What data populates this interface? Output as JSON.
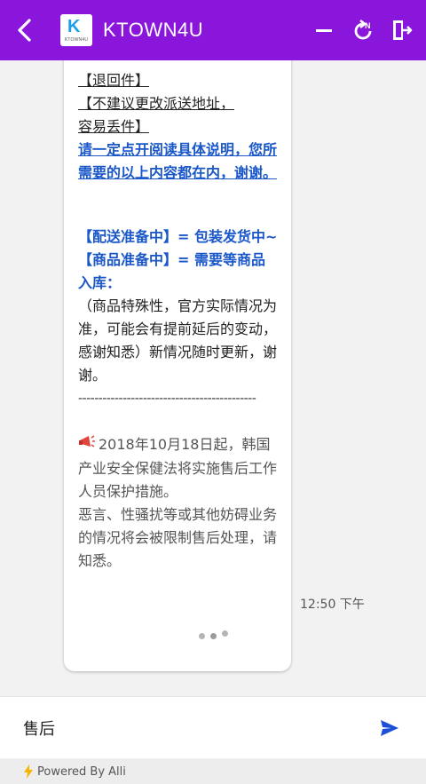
{
  "colors": {
    "appbar": "#8a16dc",
    "link_blue": "#1a57c8",
    "send_blue": "#1a4fd6",
    "bolt": "#f5b400"
  },
  "header": {
    "title": "KTOWN4U",
    "logo_letter": "K",
    "logo_text": "KTOWN4U",
    "refresh_badge": "N"
  },
  "message": {
    "lines": {
      "l1": "【退回件】",
      "l2": "【不建议更改派送地址，",
      "l3": "容易丢件】",
      "link": "请一定点开阅读具体说明，您所需要的以上内容都在内，谢谢。",
      "status1": "【配送准备中】= 包装发货中~",
      "status2": "【商品准备中】= 需要等商品入库：",
      "note": "（商品特殊性，官方实际情况为准，可能会有提前延后的变动，感谢知悉）新情况随时更新，谢谢。",
      "divider": "--------------------------------------------",
      "notice1": "2018年10月18日起，韩国产业安全保健法将实施售后工作人员保护措施。",
      "notice2": "恶言、性骚扰等或其他妨碍业务的情况将会被限制售后处理，请知悉。"
    },
    "time": "12:50 下午"
  },
  "composer": {
    "value": "售后"
  },
  "footer": {
    "powered": "Powered By Alli"
  }
}
